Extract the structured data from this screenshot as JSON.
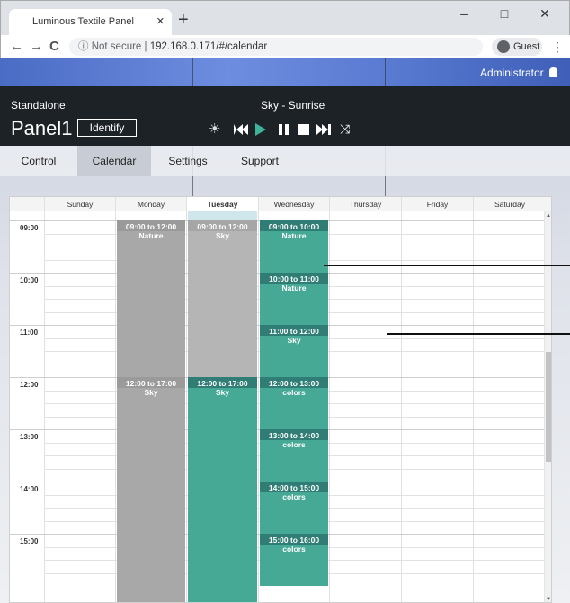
{
  "browser": {
    "tab_title": "Luminous Textile Panel",
    "tab_close": "×",
    "new_tab": "+",
    "min": "–",
    "max": "□",
    "close": "✕",
    "back": "←",
    "forward": "→",
    "reload": "C",
    "info": "ⓘ",
    "not_secure": "Not secure",
    "separator": "|",
    "url": "192.168.0.171/#/calendar",
    "profile": "Guest",
    "menu": "⋮"
  },
  "top": {
    "user": "Administrator"
  },
  "header": {
    "mode": "Standalone",
    "panel_name": "Panel1",
    "identify_label": "Identify",
    "now_playing": "Sky - Sunrise",
    "sun": "☀",
    "shuffle": "⤨"
  },
  "nav": {
    "tabs": [
      "Control",
      "Calendar",
      "Settings",
      "Support"
    ],
    "active": "Calendar"
  },
  "calendar": {
    "days": [
      "Sunday",
      "Monday",
      "Tuesday",
      "Wednesday",
      "Thursday",
      "Friday",
      "Saturday"
    ],
    "today": "Tuesday",
    "hours": [
      "09:00",
      "10:00",
      "11:00",
      "12:00",
      "13:00",
      "14:00",
      "15:00"
    ],
    "events": [
      {
        "day": "Monday",
        "time": "09:00 to 12:00",
        "name": "Nature"
      },
      {
        "day": "Monday",
        "time": "12:00 to 17:00",
        "name": "Sky"
      },
      {
        "day": "Tuesday",
        "time": "09:00 to 12:00",
        "name": "Sky"
      },
      {
        "day": "Tuesday",
        "time": "12:00 to 17:00",
        "name": "Sky"
      },
      {
        "day": "Wednesday",
        "time": "09:00 to 10:00",
        "name": "Nature"
      },
      {
        "day": "Wednesday",
        "time": "10:00 to 11:00",
        "name": "Nature"
      },
      {
        "day": "Wednesday",
        "time": "11:00 to 12:00",
        "name": "Sky"
      },
      {
        "day": "Wednesday",
        "time": "12:00 to 13:00",
        "name": "colors"
      },
      {
        "day": "Wednesday",
        "time": "13:00 to 14:00",
        "name": "colors"
      },
      {
        "day": "Wednesday",
        "time": "14:00 to 15:00",
        "name": "colors"
      },
      {
        "day": "Wednesday",
        "time": "15:00 to 16:00",
        "name": "colors"
      }
    ]
  },
  "colors": {
    "teal": "#45a995",
    "grey": "#a8a8a8",
    "header_bg": "#1d2227",
    "play": "#3fb39a"
  }
}
